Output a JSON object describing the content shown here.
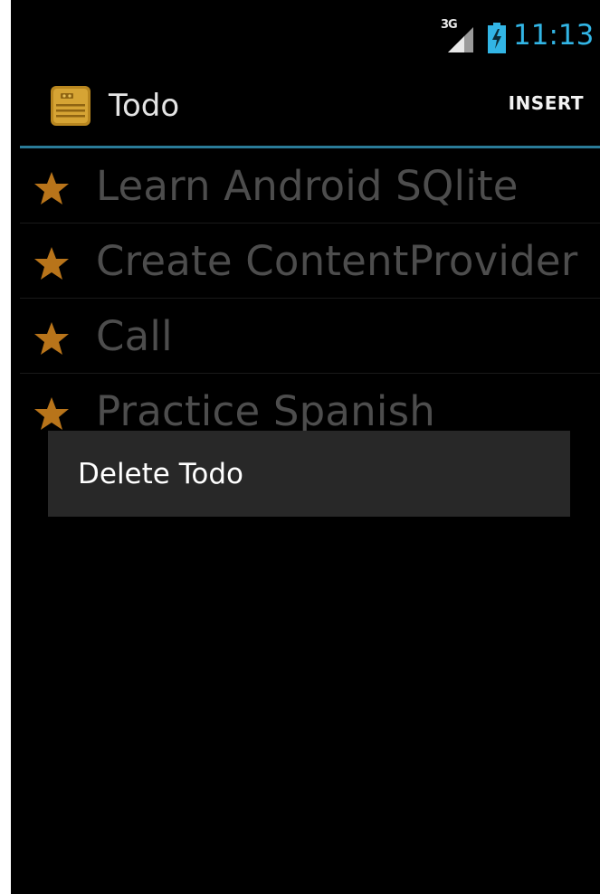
{
  "status_bar": {
    "network": "3G",
    "time": "11:13",
    "accent_color": "#32b5e5"
  },
  "action_bar": {
    "title": "Todo",
    "insert_label": "INSERT",
    "app_icon": "notepad-icon",
    "divider_color": "#2a7b98"
  },
  "todos": [
    {
      "label": "Learn Android SQlite",
      "icon": "star-icon"
    },
    {
      "label": "Create ContentProvider",
      "icon": "star-icon"
    },
    {
      "label": "Call",
      "icon": "star-icon"
    },
    {
      "label": "Practice Spanish",
      "icon": "star-icon"
    }
  ],
  "context_menu": {
    "items": [
      {
        "label": "Delete Todo"
      }
    ]
  },
  "colors": {
    "star": "#b8741a",
    "list_text": "#4d4d4d",
    "menu_background": "#282828"
  }
}
